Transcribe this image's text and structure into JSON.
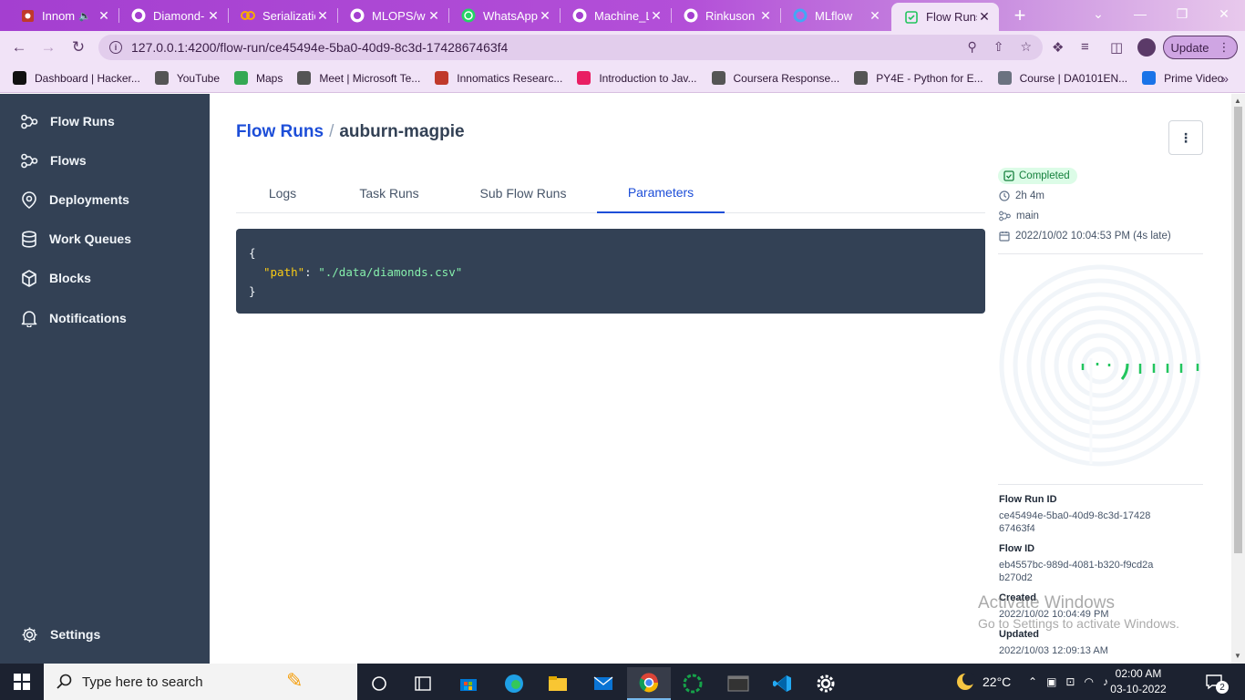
{
  "browser": {
    "tabs": [
      {
        "title": "Innom",
        "icon": "innomatics-icon",
        "muted": true
      },
      {
        "title": "Diamond-",
        "icon": "github-icon"
      },
      {
        "title": "Serializatio",
        "icon": "colab-icon"
      },
      {
        "title": "MLOPS/w",
        "icon": "github-icon"
      },
      {
        "title": "WhatsApp",
        "icon": "whatsapp-icon"
      },
      {
        "title": "Machine_L",
        "icon": "github-icon"
      },
      {
        "title": "Rinkuson",
        "icon": "github-icon"
      },
      {
        "title": "MLflow",
        "icon": "mlflow-icon"
      },
      {
        "title": "Flow Runs",
        "icon": "prefect-icon",
        "active": true
      }
    ],
    "url": "127.0.0.1:4200/flow-run/ce45494e-5ba0-40d9-8c3d-1742867463f4",
    "update_label": "Update",
    "bookmarks": [
      {
        "label": "Dashboard | Hacker...",
        "color": "#111111"
      },
      {
        "label": "YouTube",
        "color": "#555555"
      },
      {
        "label": "Maps",
        "color": "#34a853"
      },
      {
        "label": "Meet | Microsoft Te...",
        "color": "#555555"
      },
      {
        "label": "Innomatics Researc...",
        "color": "#c0392b"
      },
      {
        "label": "Introduction to Jav...",
        "color": "#e91e63"
      },
      {
        "label": "Coursera Response...",
        "color": "#555555"
      },
      {
        "label": "PY4E - Python for E...",
        "color": "#555555"
      },
      {
        "label": "Course | DA0101EN...",
        "color": "#6b7280"
      },
      {
        "label": "Prime Video",
        "color": "#1a73e8"
      }
    ]
  },
  "sidebar": {
    "items": [
      {
        "label": "Flow Runs",
        "icon": "flow-runs-icon"
      },
      {
        "label": "Flows",
        "icon": "flows-icon"
      },
      {
        "label": "Deployments",
        "icon": "location-pin-icon"
      },
      {
        "label": "Work Queues",
        "icon": "database-icon"
      },
      {
        "label": "Blocks",
        "icon": "cube-icon"
      },
      {
        "label": "Notifications",
        "icon": "bell-icon"
      }
    ],
    "settings_label": "Settings"
  },
  "page": {
    "breadcrumb_link": "Flow Runs",
    "breadcrumb_sep": "/",
    "run_name": "auburn-magpie",
    "tabs": [
      "Logs",
      "Task Runs",
      "Sub Flow Runs",
      "Parameters"
    ],
    "selected_tab": "Parameters",
    "parameters": {
      "open": "{",
      "key": "\"path\"",
      "colon": ": ",
      "value": "\"./data/diamonds.csv\"",
      "close": "}"
    }
  },
  "run_details": {
    "status": "Completed",
    "status_color": "#15803d",
    "duration": "2h 4m",
    "deployment": "main",
    "start_time": "2022/10/02 10:04:53 PM (4s late)",
    "flow_run_id_label": "Flow Run ID",
    "flow_run_id": "ce45494e-5ba0-40d9-8c3d-1742867463f4",
    "flow_id_label": "Flow ID",
    "flow_id": "eb4557bc-989d-4081-b320-f9cd2ab270d2",
    "created_label": "Created",
    "created": "2022/10/02 10:04:49 PM",
    "updated_label": "Updated",
    "updated": "2022/10/03 12:09:13 AM"
  },
  "watermark": {
    "line1": "Activate Windows",
    "line2": "Go to Settings to activate Windows."
  },
  "taskbar": {
    "search_placeholder": "Type here to search",
    "temperature": "22°C",
    "time": "02:00 AM",
    "date": "03-10-2022",
    "notifications": "2"
  }
}
